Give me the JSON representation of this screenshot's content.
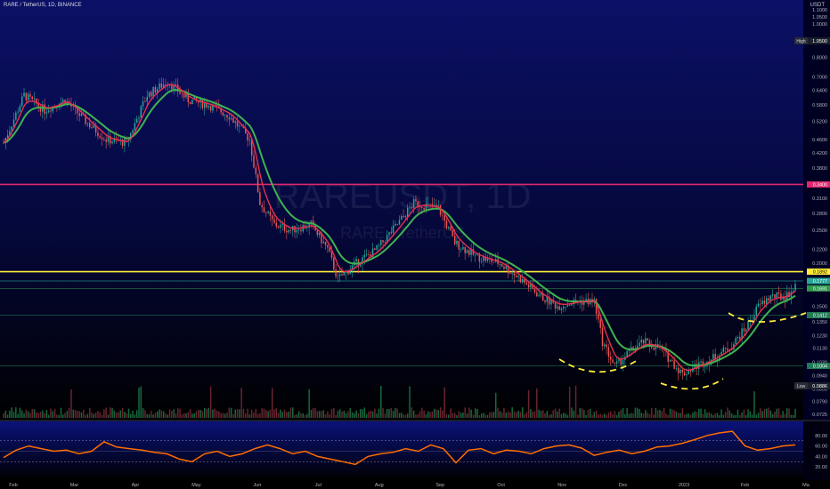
{
  "header": {
    "symbol_line": "RARE / TetherUS, 1D, BINANCE",
    "quote_currency": "USDT"
  },
  "watermark": {
    "symbol": "RAREUSDT, 1D",
    "description": "RARE / TetherUS"
  },
  "colors": {
    "background_top": "#0b1066",
    "background_bottom": "#000000",
    "up_candle": "#26a69a",
    "down_candle": "#ef5350",
    "ema_fast": "#e8304e",
    "ema_slow": "#3fb34f",
    "resistance_line": "#e0276d",
    "support_line": "#ffeb3b",
    "rsi_line": "#ff6d00",
    "pattern_curve": "#ffeb3b"
  },
  "price_scale": {
    "ticks": [
      "1.1000",
      "1.0500",
      "1.0000",
      "0.9000",
      "0.8000",
      "0.7000",
      "0.6400",
      "0.5800",
      "0.5200",
      "0.4600",
      "0.4200",
      "0.3800",
      "0.3100",
      "0.2800",
      "0.2500",
      "0.2200",
      "0.2000",
      "0.1500",
      "0.1350",
      "0.1230",
      "0.1130",
      "0.1030",
      "0.0940",
      "0.0860",
      "0.0790",
      "0.0725"
    ],
    "high_label": "High",
    "high_value": "1.0500",
    "low_label": "Low",
    "low_value": "0.0886"
  },
  "chart_data": {
    "type": "line",
    "title": "RARE / TetherUS, 1D, BINANCE",
    "xlabel": "",
    "ylabel": "",
    "y_scale": "log",
    "ylim": [
      0.0725,
      1.12
    ],
    "x_ticks": [
      "Feb",
      "Mar",
      "Apr",
      "May",
      "Jun",
      "Jul",
      "Aug",
      "Sep",
      "Oct",
      "Nov",
      "Dec",
      "2023",
      "Feb",
      "Ma"
    ],
    "series": [
      {
        "points": [
          [
            0,
            0.45
          ],
          [
            10,
            0.62
          ],
          [
            20,
            0.56
          ],
          [
            30,
            0.6
          ],
          [
            40,
            0.52
          ],
          [
            50,
            0.46
          ],
          [
            60,
            0.45
          ],
          [
            70,
            0.62
          ],
          [
            80,
            0.68
          ],
          [
            90,
            0.6
          ],
          [
            100,
            0.58
          ],
          [
            110,
            0.54
          ],
          [
            120,
            0.46
          ],
          [
            125,
            0.3
          ],
          [
            132,
            0.26
          ],
          [
            140,
            0.25
          ],
          [
            150,
            0.26
          ],
          [
            158,
            0.22
          ],
          [
            163,
            0.18
          ],
          [
            172,
            0.2
          ],
          [
            182,
            0.22
          ],
          [
            192,
            0.26
          ],
          [
            200,
            0.3
          ],
          [
            212,
            0.29
          ],
          [
            220,
            0.23
          ],
          [
            230,
            0.21
          ],
          [
            242,
            0.2
          ],
          [
            252,
            0.18
          ],
          [
            262,
            0.16
          ],
          [
            270,
            0.15
          ],
          [
            280,
            0.155
          ],
          [
            288,
            0.155
          ],
          [
            292,
            0.118
          ],
          [
            298,
            0.1
          ],
          [
            305,
            0.11
          ],
          [
            312,
            0.118
          ],
          [
            320,
            0.113
          ],
          [
            326,
            0.103
          ],
          [
            331,
            0.095
          ],
          [
            337,
            0.1
          ],
          [
            345,
            0.105
          ],
          [
            355,
            0.115
          ],
          [
            362,
            0.13
          ],
          [
            368,
            0.15
          ],
          [
            374,
            0.16
          ],
          [
            381,
            0.16
          ],
          [
            386,
            0.17
          ]
        ]
      }
    ],
    "horizontal_levels": [
      {
        "label": "0.3400",
        "value": 0.34,
        "color": "#e0276d"
      },
      {
        "label": "0.1892",
        "value": 0.1892,
        "color": "#ffeb3b"
      },
      {
        "label": "0.1777",
        "value": 0.1777,
        "color": "#26a69a"
      },
      {
        "label": "0.1691",
        "value": 0.1691,
        "color": "#2e9a4e"
      },
      {
        "label": "0.1412",
        "value": 0.1412,
        "color": "#1f7a55"
      },
      {
        "label": "0.1004",
        "value": 0.1004,
        "color": "#1f7a55"
      }
    ],
    "rsi": {
      "ticks": [
        "80.00",
        "60.00",
        "40.00",
        "20.00"
      ],
      "ylim": [
        0,
        100
      ],
      "bands": [
        70,
        50,
        30
      ],
      "values": [
        38,
        52,
        60,
        55,
        50,
        52,
        45,
        50,
        68,
        58,
        55,
        52,
        48,
        45,
        35,
        30,
        45,
        50,
        40,
        45,
        55,
        62,
        55,
        45,
        50,
        40,
        35,
        30,
        25,
        40,
        45,
        48,
        55,
        50,
        62,
        55,
        28,
        52,
        55,
        45,
        52,
        50,
        45,
        55,
        60,
        62,
        56,
        42,
        48,
        52,
        45,
        50,
        58,
        60,
        65,
        72,
        80,
        85,
        88,
        60,
        52,
        55,
        60,
        62
      ]
    }
  }
}
